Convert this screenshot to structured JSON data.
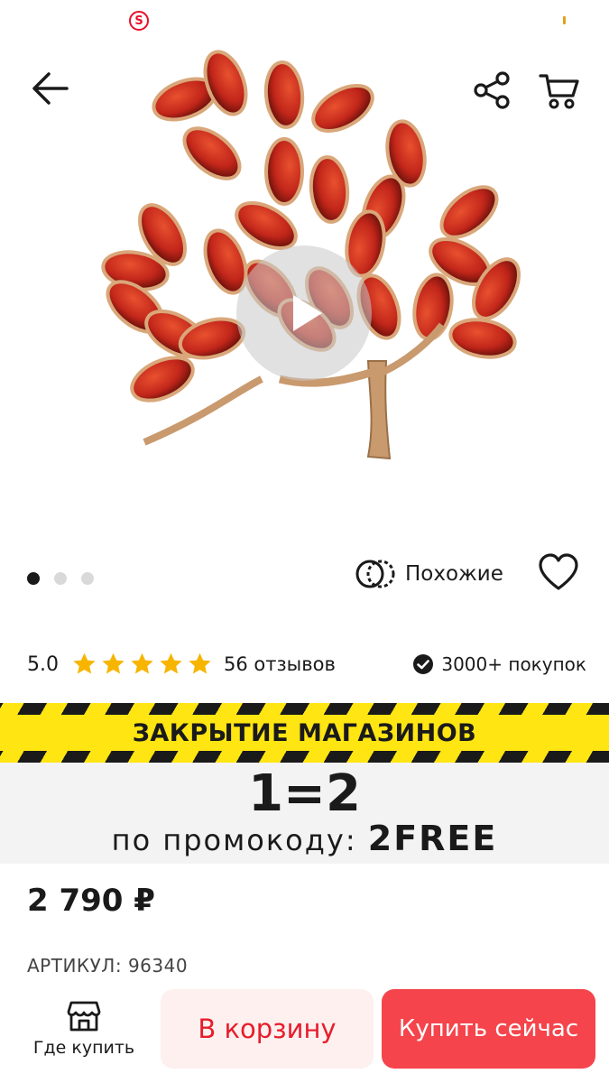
{
  "status_bar": {
    "left_badge": "S",
    "left_icon": "s-circle-icon"
  },
  "header": {
    "back_icon": "arrow-left-icon",
    "share_icon": "share-icon",
    "cart_icon": "cart-icon"
  },
  "gallery": {
    "image_description_icon": "amber-tree-brooch-image",
    "play_icon": "play-icon",
    "dots": 3,
    "active_dot": 0,
    "similar_label": "Похожие",
    "favorite_icon": "heart-icon"
  },
  "rating": {
    "value": "5.0",
    "stars": 5,
    "reviews_label": "56 отзывов",
    "purchases_label": "3000+ покупок",
    "star_color": "#f7b500"
  },
  "promo": {
    "banner_title": "ЗАКРЫТИЕ МАГАЗИНОВ",
    "big_text": "1=2",
    "code_prefix": "по промокоду:",
    "code": "2FREE",
    "banner_color": "#ffe512"
  },
  "product": {
    "price": "2 790 ₽",
    "article": "АРТИКУЛ: 96340"
  },
  "bottom_bar": {
    "where_buy_label": "Где купить",
    "where_buy_icon": "store-icon",
    "add_to_cart_label": "В корзину",
    "buy_now_label": "Купить сейчас",
    "accent_color": "#f5444b"
  }
}
